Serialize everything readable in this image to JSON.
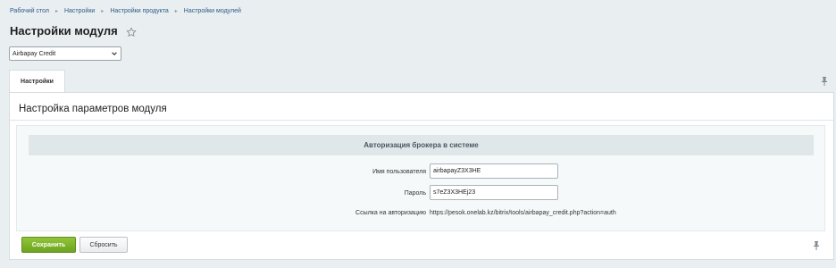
{
  "breadcrumb": {
    "items": [
      "Рабочий стол",
      "Настройки",
      "Настройки продукта",
      "Настройки модулей"
    ]
  },
  "page": {
    "title": "Настройки модуля"
  },
  "module_select": {
    "value": "Airbapay Credit"
  },
  "tabs": [
    {
      "label": "Настройки"
    }
  ],
  "panel": {
    "heading": "Настройка параметров модуля",
    "section_title": "Авторизация брокера в системе",
    "fields": {
      "username": {
        "label": "Имя пользователя",
        "value": "airbapayZ3X3HE"
      },
      "password": {
        "label": "Пароль",
        "value": "s7eZ3X3HEj23"
      },
      "auth_link": {
        "label": "Ссылка на авторизацию",
        "value": "https://pesok.onelab.kz/bitrix/tools/airbapay_credit.php?action=auth"
      }
    }
  },
  "buttons": {
    "save_label": "Сохранить",
    "reset_label": "Сбросить"
  },
  "colors": {
    "background": "#e9eef0",
    "save_button": "#7bb12a",
    "section_header": "#e0e7e9"
  }
}
